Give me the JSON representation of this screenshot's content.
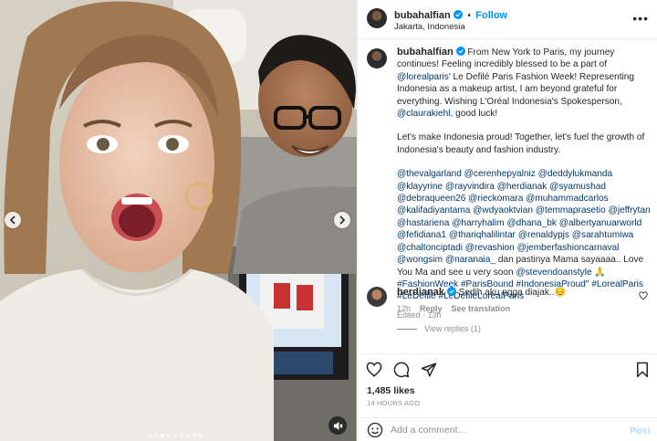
{
  "post": {
    "username": "bubahalfian",
    "follow_label": "Follow",
    "separator": "•",
    "location": "Jakarta, Indonesia",
    "more_label": "•••"
  },
  "caption": {
    "username": "bubahalfian",
    "p1_pre": "From New York to Paris, my journey continues! Feeling incredibly blessed to be a part of ",
    "p1_tag": "@lorealparis",
    "p1_post": "' Le Defilé Paris Fashion Week! Representing Indonesia as a makeup artist, I am beyond grateful for everything. Wishing L'Oréal Indonesia's Spokesperson, ",
    "p1_tag2": "@claurakiehl",
    "p1_end": ", good luck!",
    "p2": "Let's make Indonesia proud! Together, let's fuel the growth of Indonesia's beauty and fashion industry.",
    "p3_tags": "@thevalgarland @cerenhepyalniz @deddylukmanda @klayyrine @rayvindira @herdianak @syamushad @debraqueen26 @rieckomara @muhammadcarlos @kalifadiyantama @wdyaoktvian @temmaprasetio @jeffrytan @hastariena @harryhalim @dhana_bk @albertyanuarworld @fefidiana1 @thariqhalilintar @renaldypjs @sarahtumiwa @chaltonciptadi @revashion @jemberfashioncarnaval @wongsim @naranaia_",
    "p3_text1": " dan pastinya Mama sayaaaa.. Love You Ma and see u very soon ",
    "p3_tag_last": "@stevendoanstyle",
    "p3_emoji": " 🙏 ",
    "p3_hashtags": "#FashionWeek #ParisBound #IndonesiaProud\" #LorealParis #LeDefile #LeDefileLorealParis",
    "meta": "Edited · 13h"
  },
  "comment": {
    "username": "herdianak",
    "text": " Sedih aku ngga diajak..",
    "emoji": "😔",
    "time": "12h",
    "reply_label": "Reply",
    "translate_label": "See translation",
    "view_replies": "View replies (1)"
  },
  "actions": {
    "likes": "1,485 likes",
    "time_ago": "14 HOURS AGO"
  },
  "add_comment": {
    "placeholder": "Add a comment…",
    "post_label": "Post"
  },
  "colors": {
    "accent": "#0095f6",
    "link": "#00376b",
    "muted": "#8e8e8e",
    "post_disabled": "#b3dbff"
  },
  "icons": [
    "chevron-left-icon",
    "chevron-right-icon",
    "mute-icon",
    "verified-icon",
    "heart-icon",
    "comment-icon",
    "share-icon",
    "bookmark-icon",
    "emoji-icon"
  ],
  "carousel": {
    "slides": 9,
    "active_index": 2
  }
}
